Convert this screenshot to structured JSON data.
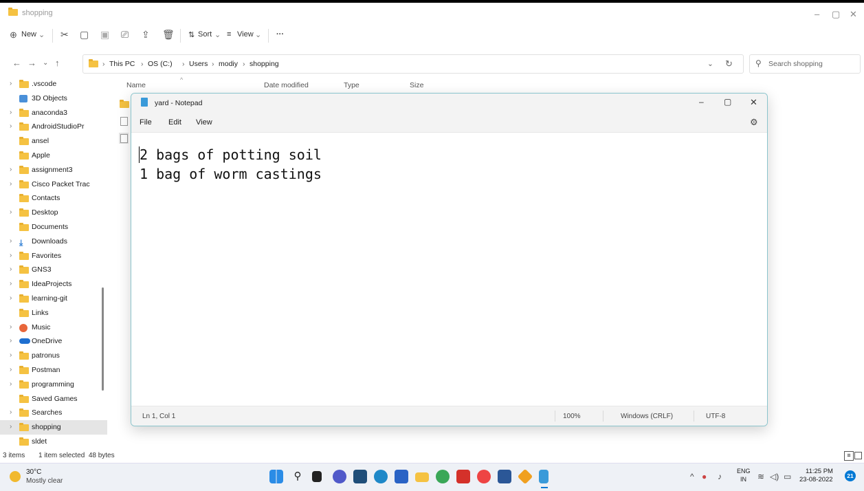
{
  "explorer": {
    "title": "shopping",
    "window_controls": {
      "minimize": "–",
      "maximize": "▢",
      "close": "✕"
    },
    "toolbar": {
      "new_label": "New",
      "sort_label": "Sort",
      "view_label": "View",
      "more_label": "···"
    },
    "breadcrumb": [
      "This PC",
      "OS (C:)",
      "Users",
      "modiy",
      "shopping"
    ],
    "search_placeholder": "Search shopping",
    "columns": [
      "Name",
      "Date modified",
      "Type",
      "Size"
    ],
    "sidebar": [
      {
        "label": ".vscode",
        "chev": true,
        "icon": "folder-icon"
      },
      {
        "label": "3D Objects",
        "chev": false,
        "icon": "cube-icon"
      },
      {
        "label": "anaconda3",
        "chev": true,
        "icon": "folder-icon"
      },
      {
        "label": "AndroidStudioPr",
        "chev": true,
        "icon": "folder-icon"
      },
      {
        "label": "ansel",
        "chev": false,
        "icon": "folder-icon"
      },
      {
        "label": "Apple",
        "chev": false,
        "icon": "folder-icon"
      },
      {
        "label": "assignment3",
        "chev": true,
        "icon": "folder-icon"
      },
      {
        "label": "Cisco Packet Trac",
        "chev": true,
        "icon": "folder-icon"
      },
      {
        "label": "Contacts",
        "chev": false,
        "icon": "folder-icon"
      },
      {
        "label": "Desktop",
        "chev": true,
        "icon": "folder-icon"
      },
      {
        "label": "Documents",
        "chev": false,
        "icon": "folder-icon"
      },
      {
        "label": "Downloads",
        "chev": true,
        "icon": "download-icon"
      },
      {
        "label": "Favorites",
        "chev": true,
        "icon": "folder-icon"
      },
      {
        "label": "GNS3",
        "chev": true,
        "icon": "folder-icon"
      },
      {
        "label": "IdeaProjects",
        "chev": true,
        "icon": "folder-icon"
      },
      {
        "label": "learning-git",
        "chev": true,
        "icon": "folder-icon"
      },
      {
        "label": "Links",
        "chev": false,
        "icon": "folder-icon"
      },
      {
        "label": "Music",
        "chev": true,
        "icon": "music-icon"
      },
      {
        "label": "OneDrive",
        "chev": true,
        "icon": "cloud-icon"
      },
      {
        "label": "patronus",
        "chev": true,
        "icon": "folder-icon"
      },
      {
        "label": "Postman",
        "chev": true,
        "icon": "folder-icon"
      },
      {
        "label": "programming",
        "chev": true,
        "icon": "folder-icon"
      },
      {
        "label": "Saved Games",
        "chev": false,
        "icon": "folder-icon"
      },
      {
        "label": "Searches",
        "chev": true,
        "icon": "folder-icon"
      },
      {
        "label": "shopping",
        "chev": true,
        "icon": "folder-icon",
        "selected": true
      },
      {
        "label": "sldet",
        "chev": false,
        "icon": "folder-icon"
      }
    ],
    "status_items": "3 items",
    "status_selected": "1 item selected  48 bytes"
  },
  "notepad": {
    "title": "yard - Notepad",
    "menu": [
      "File",
      "Edit",
      "View"
    ],
    "content_lines": [
      "2 bags of potting soil",
      "1 bag of worm castings"
    ],
    "status_position": "Ln 1, Col 1",
    "status_zoom": "100%",
    "status_eol": "Windows (CRLF)",
    "status_encoding": "UTF-8"
  },
  "taskbar": {
    "weather_temp": "30°C",
    "weather_desc": "Mostly clear",
    "lang_top": "ENG",
    "lang_bottom": "IN",
    "time": "11:25 PM",
    "date": "23-08-2022",
    "notification_count": "21",
    "apps": [
      "windows-start",
      "search",
      "file-explorer",
      "teams",
      "store",
      "edge",
      "vscode",
      "file-explorer-2",
      "chrome",
      "acrobat",
      "chrome-2",
      "word",
      "sourcetree",
      "notepad"
    ]
  },
  "colors": {
    "accent": "#0078d4",
    "folder": "#f5c242"
  }
}
